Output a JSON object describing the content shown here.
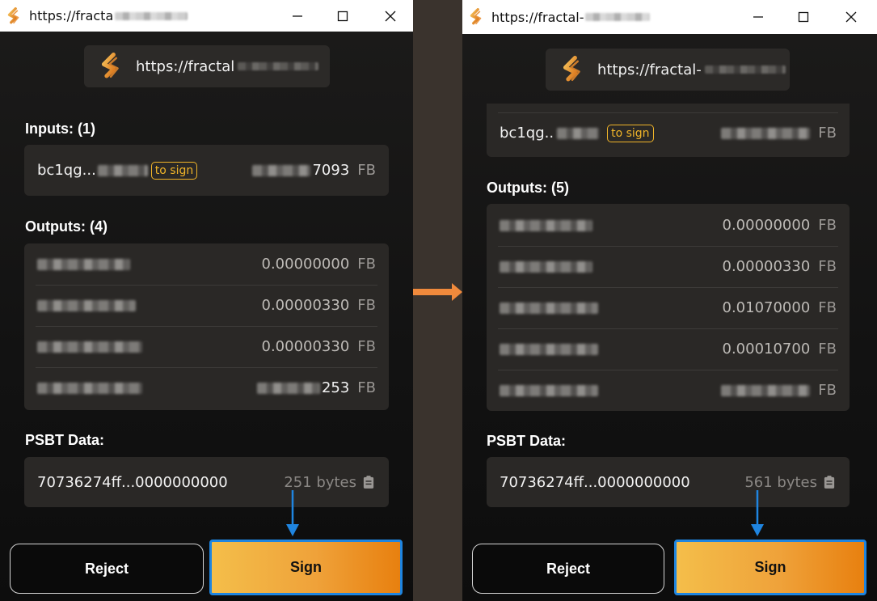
{
  "colors": {
    "accent": "#f0b429",
    "sign_start": "#f4be4a",
    "sign_end": "#e8800f",
    "highlight_blue": "#1f85e0",
    "transition_arrow": "#f08a3c"
  },
  "left": {
    "window_title": "https://fracta",
    "site_url": "https://fractal",
    "inputs_label": "Inputs: (1)",
    "inputs": [
      {
        "address": "bc1qg...",
        "tag": "to sign",
        "amount": "7093",
        "unit": "FB"
      }
    ],
    "outputs_label": "Outputs: (4)",
    "outputs": [
      {
        "amount": "0.00000000",
        "unit": "FB"
      },
      {
        "amount": "0.00000330",
        "unit": "FB"
      },
      {
        "amount": "0.00000330",
        "unit": "FB"
      },
      {
        "amount": "253",
        "unit": "FB"
      }
    ],
    "psbt_label": "PSBT Data:",
    "psbt_hex": "70736274ff...0000000000",
    "psbt_size": "251 bytes",
    "reject_label": "Reject",
    "sign_label": "Sign"
  },
  "right": {
    "window_title": "https://fractal-",
    "site_url": "https://fractal-",
    "inputs": [
      {
        "address": "bc1qg..",
        "tag": "to sign",
        "unit": "FB"
      }
    ],
    "outputs_label": "Outputs: (5)",
    "outputs": [
      {
        "amount": "0.00000000",
        "unit": "FB"
      },
      {
        "amount": "0.00000330",
        "unit": "FB"
      },
      {
        "amount": "0.01070000",
        "unit": "FB"
      },
      {
        "amount": "0.00010700",
        "unit": "FB"
      },
      {
        "amount": "",
        "unit": "FB"
      }
    ],
    "psbt_label": "PSBT Data:",
    "psbt_hex": "70736274ff...0000000000",
    "psbt_size": "561 bytes",
    "reject_label": "Reject",
    "sign_label": "Sign"
  },
  "icons": {
    "app": "fractal-s-logo-icon",
    "minimize": "minimize-icon",
    "maximize": "maximize-icon",
    "close": "close-icon",
    "copy": "clipboard-icon",
    "arrow": "arrow-down-icon"
  }
}
